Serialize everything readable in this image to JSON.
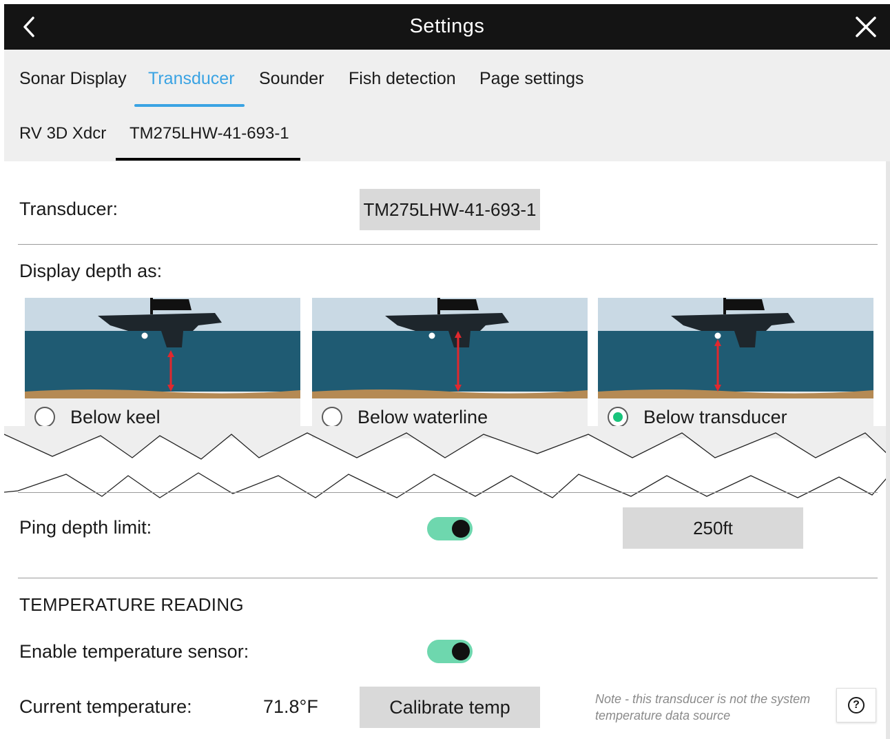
{
  "header": {
    "title": "Settings",
    "back_icon": "back-chevron-icon",
    "close_icon": "close-icon"
  },
  "tabs": [
    {
      "label": "Sonar Display",
      "active": false
    },
    {
      "label": "Transducer",
      "active": true
    },
    {
      "label": "Sounder",
      "active": false
    },
    {
      "label": "Fish detection",
      "active": false
    },
    {
      "label": "Page settings",
      "active": false
    }
  ],
  "subtabs": [
    {
      "label": "RV 3D Xdcr",
      "active": false
    },
    {
      "label": "TM275LHW-41-693-1",
      "active": true
    }
  ],
  "transducer": {
    "label": "Transducer:",
    "value": "TM275LHW-41-693-1"
  },
  "depth": {
    "label": "Display depth as:",
    "options": [
      {
        "label": "Below keel",
        "selected": false
      },
      {
        "label": "Below waterline",
        "selected": false
      },
      {
        "label": "Below transducer",
        "selected": true
      }
    ]
  },
  "ping": {
    "label": "Ping depth limit:",
    "toggle_on": true,
    "value": "250ft"
  },
  "temperature": {
    "section_title": "TEMPERATURE READING",
    "enable_label": "Enable temperature sensor:",
    "enable_on": true,
    "current_label": "Current temperature:",
    "current_value": "71.8°F",
    "calibrate_label": "Calibrate temp",
    "note": "Note - this transducer is not the system temperature data source",
    "help_icon": "help-icon",
    "help_symbol": "?"
  },
  "colors": {
    "accent": "#3aa3e3",
    "toggle_on": "#6ed7ae",
    "radio_selected": "#19c47c",
    "sky": "#c9d9e4",
    "water": "#1f5b73",
    "seabed": "#b58a54",
    "depth_arrow": "#e0282e"
  }
}
